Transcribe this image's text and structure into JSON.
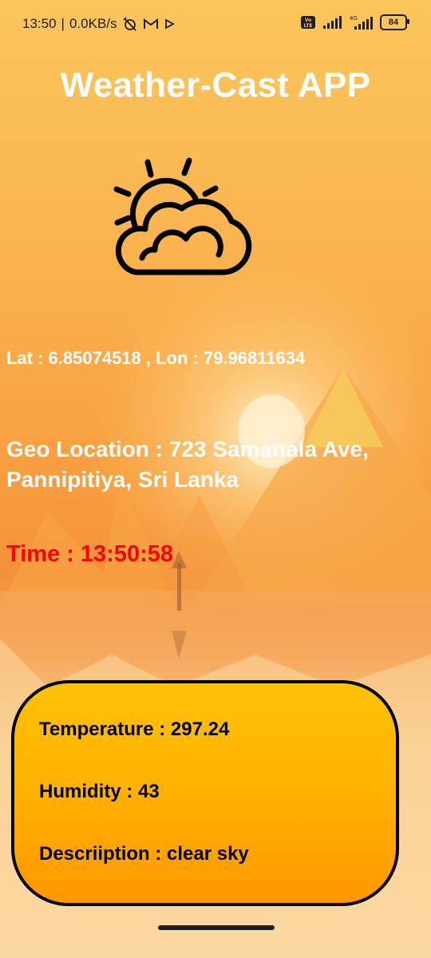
{
  "status_bar": {
    "time": "13:50",
    "network_speed": "0.0KB/s",
    "battery": "84",
    "icons": [
      "alarm-off-icon",
      "gmail-icon",
      "play-icon",
      "volte-icon",
      "signal-icon",
      "4g-signal-icon",
      "battery-icon"
    ]
  },
  "app": {
    "title": "Weather-Cast APP",
    "weather_icon": "partly-cloudy-icon"
  },
  "location": {
    "lat_lon": "Lat : 6.85074518 , Lon : 79.96811634",
    "geo": "Geo Location : 723 Samanala Ave, Pannipitiya, Sri Lanka"
  },
  "time_display": "Time : 13:50:58",
  "weather": {
    "temperature": "Temperature : 297.24",
    "humidity": "Humidity : 43",
    "description": "Descriiption : clear sky"
  },
  "colors": {
    "title": "#FFFFFF",
    "time_text": "#FF0000",
    "card_top": "#FFC107",
    "card_bottom": "#FF9800"
  }
}
